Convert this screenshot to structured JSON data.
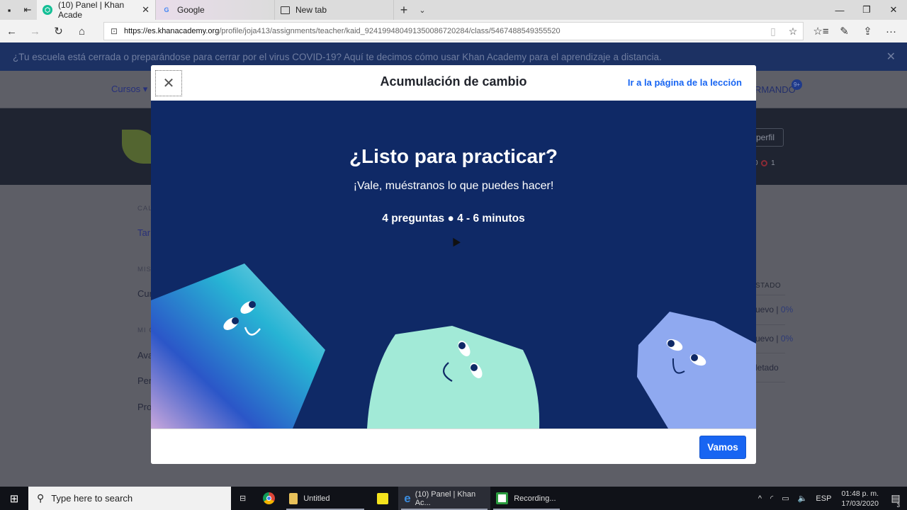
{
  "browser": {
    "tabs": [
      {
        "label": "(10) Panel | Khan Acade",
        "active": true,
        "favicon": "khan-academy-icon"
      },
      {
        "label": "Google",
        "active": false,
        "favicon": "google-icon"
      },
      {
        "label": "New tab",
        "active": false,
        "favicon": "new-tab-icon"
      }
    ],
    "url_host": "https://es.khanacademy.org",
    "url_path": "/profile/joja413/assignments/teacher/kaid_924199480491350086720284/class/5467488549355520",
    "icons": {
      "close_tab": "✕",
      "new_tab": "+",
      "tab_menu": "⌄",
      "minimize": "—",
      "restore": "❐",
      "close": "✕",
      "back": "←",
      "forward": "→",
      "refresh": "↻",
      "home": "⌂",
      "lock": "🔒",
      "reading": "📖",
      "star": "☆",
      "favorites": "✰",
      "pen": "✎",
      "share": "⇪",
      "more": "···"
    }
  },
  "page": {
    "banner_text": "¿Tu escuela está cerrada o preparándose para cerrar por el virus COVID-19? Aquí te decimos cómo usar Khan Academy para el aprendizaje a distancia.",
    "banner_close": "✕",
    "nav_cursos": "Cursos ▾",
    "username": "RMANDO",
    "notif_badge": "9+",
    "perfil_button": "perfil",
    "stats": {
      "a": "0",
      "b": "1"
    },
    "sidebar": [
      {
        "text": "CAL",
        "type": "label"
      },
      {
        "text": "Tar",
        "type": "link"
      },
      {
        "text": "MIS",
        "type": "label"
      },
      {
        "text": "Cur",
        "type": "item"
      },
      {
        "text": "MI C",
        "type": "label"
      },
      {
        "text": "Ava",
        "type": "item"
      },
      {
        "text": "Per",
        "type": "item"
      },
      {
        "text": "Pro",
        "type": "item"
      }
    ],
    "status_column": {
      "header": "STADO",
      "rows": [
        {
          "status": "uevo | ",
          "percent": "0%"
        },
        {
          "status": "uevo | ",
          "percent": "0%"
        },
        {
          "status": "letado",
          "percent": ""
        }
      ]
    }
  },
  "modal": {
    "title": "Acumulación de cambio",
    "close_icon": "✕",
    "lesson_link": "Ir a la página de la lección",
    "heading": "¿Listo para practicar?",
    "subheading": "¡Vale, muéstranos lo que puedes hacer!",
    "meta": "4 preguntas ● 4 - 6 minutos",
    "primary_button": "Vamos",
    "colors": {
      "body_bg": "#0f2966",
      "button": "#1865f2",
      "link": "#1865f2"
    }
  },
  "taskbar": {
    "search_placeholder": "Type here to search",
    "items": [
      {
        "label": "",
        "icon": "task-view-icon"
      },
      {
        "label": "",
        "icon": "chrome-icon"
      },
      {
        "label": "Untitled",
        "icon": "file-explorer-icon"
      },
      {
        "label": "",
        "icon": "sticky-notes-icon"
      },
      {
        "label": "(10) Panel | Khan Ac...",
        "icon": "edge-icon",
        "active": true
      },
      {
        "label": "Recording...",
        "icon": "camtasia-icon"
      }
    ],
    "tray": {
      "chevron": "^",
      "language": "ESP",
      "time": "01:48 p. m.",
      "date": "17/03/2020",
      "notifications": "3"
    }
  }
}
